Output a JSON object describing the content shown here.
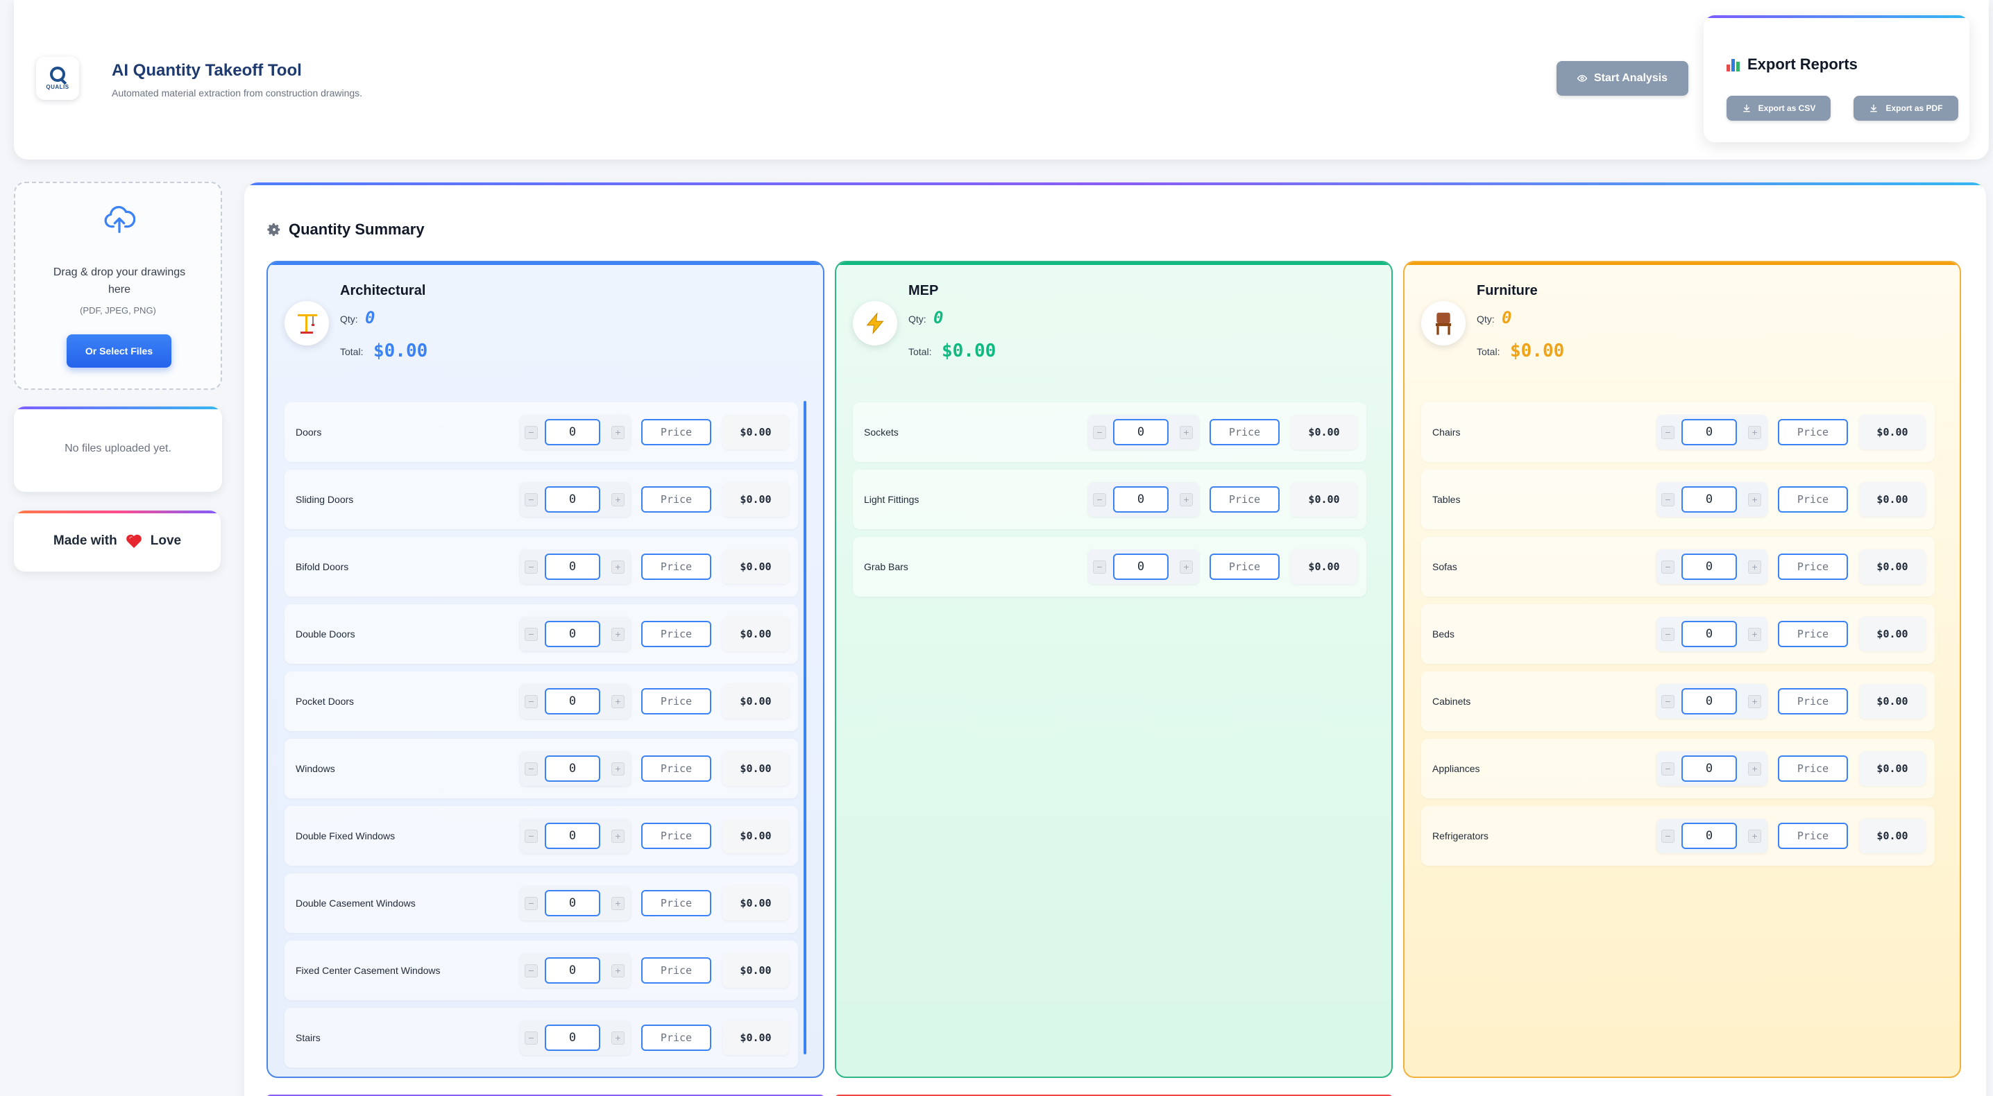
{
  "header": {
    "logo_text": "QUALIS",
    "title": "AI Quantity Takeoff Tool",
    "subtitle": "Automated material extraction from construction drawings.",
    "start_button": "Start Analysis",
    "start_icon": "eye-icon"
  },
  "export": {
    "title": "Export Reports",
    "title_icon": "bar-chart-icon",
    "csv_button": "Export as CSV",
    "pdf_button": "Export as PDF"
  },
  "upload": {
    "text": "Drag & drop your drawings here",
    "formats": "(PDF, JPEG, PNG)",
    "select_button": "Or Select Files"
  },
  "files": {
    "empty_text": "No files uploaded yet."
  },
  "love": {
    "prefix": "Made with",
    "suffix": "Love"
  },
  "summary": {
    "title": "Quantity Summary",
    "qty_label": "Qty:",
    "total_label": "Total:",
    "price_placeholder": "Price",
    "categories": [
      {
        "name": "Architectural",
        "icon": "crane-icon",
        "accent": "#3b82f6",
        "qty": "0",
        "total": "$0.00",
        "items": [
          {
            "name": "Doors",
            "qty": "0",
            "total": "$0.00"
          },
          {
            "name": "Sliding Doors",
            "qty": "0",
            "total": "$0.00"
          },
          {
            "name": "Bifold Doors",
            "qty": "0",
            "total": "$0.00"
          },
          {
            "name": "Double Doors",
            "qty": "0",
            "total": "$0.00"
          },
          {
            "name": "Pocket Doors",
            "qty": "0",
            "total": "$0.00"
          },
          {
            "name": "Windows",
            "qty": "0",
            "total": "$0.00"
          },
          {
            "name": "Double Fixed Windows",
            "qty": "0",
            "total": "$0.00"
          },
          {
            "name": "Double Casement Windows",
            "qty": "0",
            "total": "$0.00"
          },
          {
            "name": "Fixed Center Casement Windows",
            "qty": "0",
            "total": "$0.00"
          },
          {
            "name": "Stairs",
            "qty": "0",
            "total": "$0.00"
          }
        ]
      },
      {
        "name": "MEP",
        "icon": "lightning-icon",
        "accent": "#10b981",
        "qty": "0",
        "total": "$0.00",
        "items": [
          {
            "name": "Sockets",
            "qty": "0",
            "total": "$0.00"
          },
          {
            "name": "Light Fittings",
            "qty": "0",
            "total": "$0.00"
          },
          {
            "name": "Grab Bars",
            "qty": "0",
            "total": "$0.00"
          }
        ]
      },
      {
        "name": "Furniture",
        "icon": "chair-icon",
        "accent": "#f59e0b",
        "qty": "0",
        "total": "$0.00",
        "items": [
          {
            "name": "Chairs",
            "qty": "0",
            "total": "$0.00"
          },
          {
            "name": "Tables",
            "qty": "0",
            "total": "$0.00"
          },
          {
            "name": "Sofas",
            "qty": "0",
            "total": "$0.00"
          },
          {
            "name": "Beds",
            "qty": "0",
            "total": "$0.00"
          },
          {
            "name": "Cabinets",
            "qty": "0",
            "total": "$0.00"
          },
          {
            "name": "Appliances",
            "qty": "0",
            "total": "$0.00"
          },
          {
            "name": "Refrigerators",
            "qty": "0",
            "total": "$0.00"
          }
        ]
      }
    ]
  }
}
